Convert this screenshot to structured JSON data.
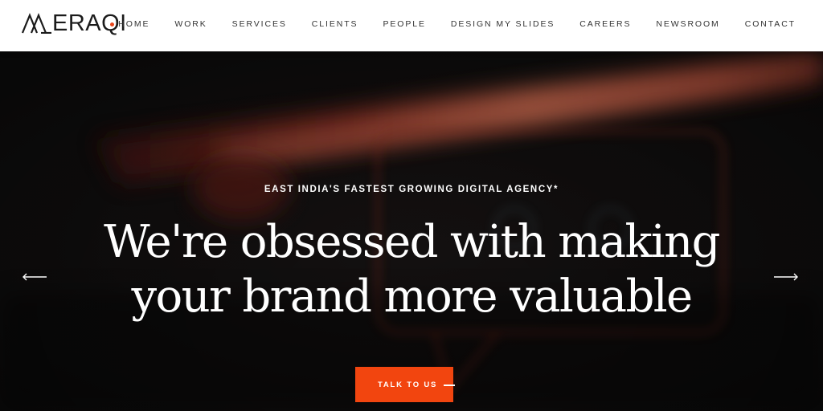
{
  "brand": {
    "logo_text": "ERAQI",
    "logo_mark_icon": "meraqi-m-mark-icon"
  },
  "nav": {
    "items": [
      {
        "label": "HOME",
        "active": true
      },
      {
        "label": "WORK"
      },
      {
        "label": "SERVICES"
      },
      {
        "label": "CLIENTS"
      },
      {
        "label": "PEOPLE"
      },
      {
        "label": "DESIGN MY SLIDES"
      },
      {
        "label": "CAREERS"
      },
      {
        "label": "NEWSROOM"
      },
      {
        "label": "CONTACT"
      }
    ],
    "active_indicator_color": "#e8451b"
  },
  "hero": {
    "eyebrow": "EAST INDIA'S FASTEST GROWING DIGITAL AGENCY*",
    "headline_line1": "We're obsessed with making",
    "headline_line2": "your brand more valuable",
    "cta_label": "TALK TO US",
    "cta_color": "#f2450f",
    "prev_icon": "arrow-left-icon",
    "next_icon": "arrow-right-icon"
  }
}
